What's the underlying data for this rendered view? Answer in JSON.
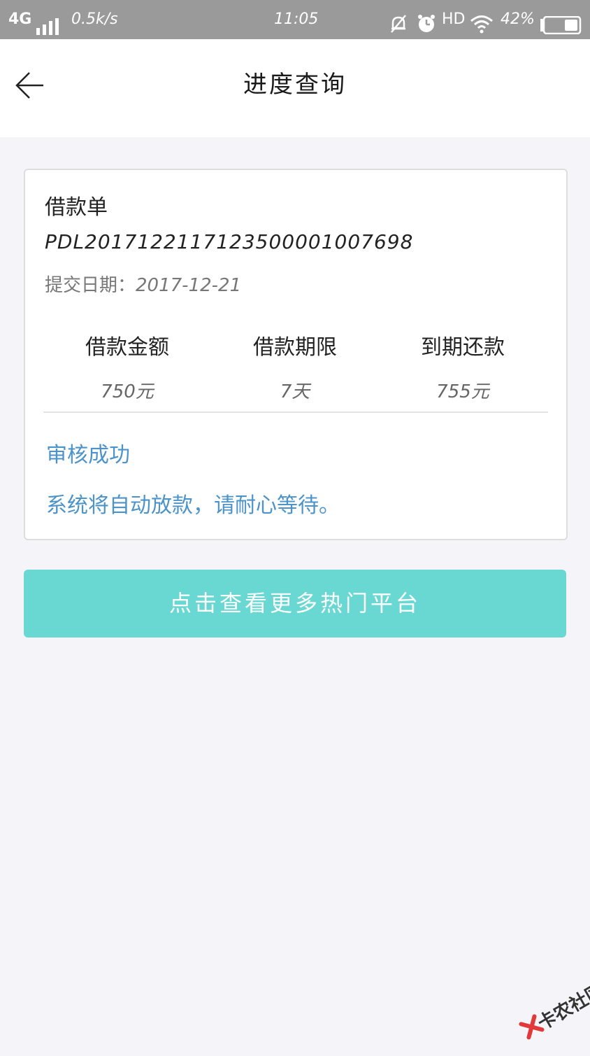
{
  "status_bar": {
    "network": "4G",
    "speed": "0.5k/s",
    "time": "11:05",
    "hd": "HD",
    "battery": "42%"
  },
  "nav": {
    "title": "进度查询",
    "back_icon": "back-arrow-icon"
  },
  "card": {
    "title": "借款单",
    "order_no": "PDL2017122117123500001007698",
    "date_label": "提交日期：",
    "date_value": "2017-12-21",
    "columns": [
      {
        "label": "借款金额",
        "value": "750元"
      },
      {
        "label": "借款期限",
        "value": "7天"
      },
      {
        "label": "到期还款",
        "value": "755元"
      }
    ],
    "status_title": "审核成功",
    "status_message": "系统将自动放款，请耐心等待。"
  },
  "cta": {
    "label": "点击查看更多热门平台"
  },
  "watermark": {
    "text": "卡农社区"
  },
  "colors": {
    "status_bar": "#9a9a9a",
    "accent_text": "#4c93c9",
    "cta_bg": "#6ad8d2",
    "page_bg": "#f4f4f9"
  }
}
